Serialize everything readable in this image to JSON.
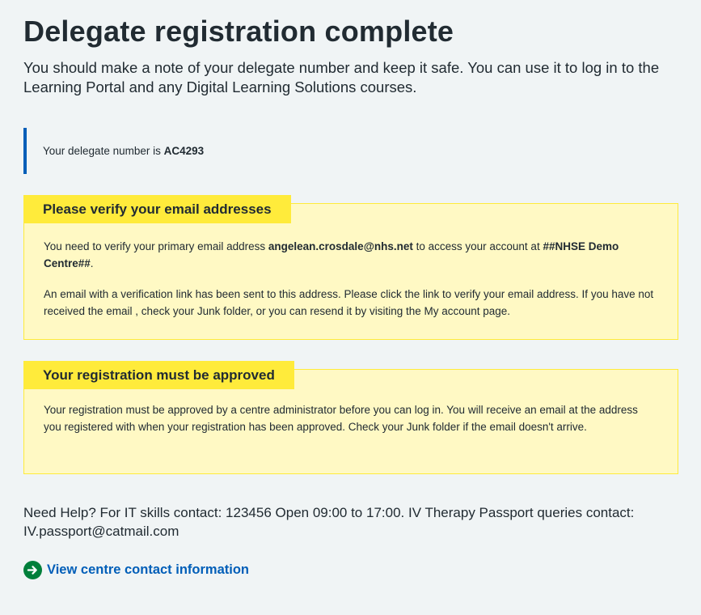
{
  "page": {
    "title": "Delegate registration complete",
    "lead": "You should make a note of your delegate number and keep it safe. You can use it to log in to the Learning Portal and any Digital Learning Solutions courses."
  },
  "delegate": {
    "prefix": "Your delegate number is ",
    "number": "AC4293"
  },
  "verify_callout": {
    "heading": "Please verify your email addresses",
    "p1_prefix": "You need to verify your primary email address ",
    "email": "angelean.crosdale@nhs.net",
    "p1_middle": " to access your account at ",
    "centre": "##NHSE Demo Centre##",
    "p1_suffix": ".",
    "p2": "An email with a verification link has been sent to this address. Please click the link to verify your email address. If you have not received the email , check your Junk folder, or you can resend it by visiting the My account page."
  },
  "approval_callout": {
    "heading": "Your registration must be approved",
    "body": "Your registration must be approved by a centre administrator before you can log in. You will receive an email at the address you registered with when your registration has been approved. Check your Junk folder if the email doesn't arrive."
  },
  "help": {
    "text": "Need Help? For IT skills contact: 123456 Open 09:00 to 17:00. IV Therapy Passport queries contact: IV.passport@catmail.com"
  },
  "contact_link": {
    "label": "View centre contact information",
    "icon": "arrow-right-circle-icon"
  },
  "colors": {
    "background": "#f0f4f5",
    "nhs_blue": "#005eb8",
    "warning_yellow": "#ffeb3b",
    "warning_bg": "#fff9c4",
    "green": "#007f3b"
  }
}
